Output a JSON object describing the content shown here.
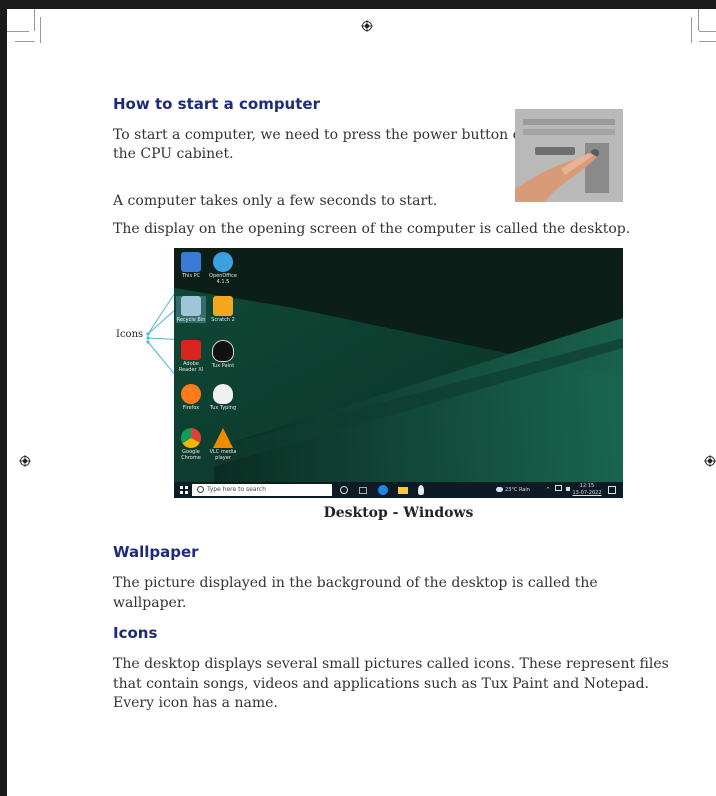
{
  "sections": {
    "start": {
      "heading": "How to start a computer",
      "para1_line1": "To start a computer, we need to press the power button on",
      "para1_line2": "the CPU cabinet.",
      "para2": "A computer takes only a few seconds to start.",
      "para3": "The display on the opening screen of the computer is called the desktop."
    },
    "figure": {
      "icons_label": "Icons",
      "caption": "Desktop - Windows",
      "desktop_icons": [
        {
          "label": "This PC",
          "color": "#3a7bd5"
        },
        {
          "label": "OpenOffice 4.1.5",
          "color": "#3aa0e0"
        },
        {
          "label": "Recycle Bin",
          "color": "#9fc6d8"
        },
        {
          "label": "Scratch 2",
          "color": "#f2a81d"
        },
        {
          "label": "Adobe Reader XI",
          "color": "#d8231f"
        },
        {
          "label": "Tux Paint",
          "color": "#111111"
        },
        {
          "label": "Firefox",
          "color": "#ff7b1a"
        },
        {
          "label": "Tux Typing",
          "color": "#f0f0f0"
        },
        {
          "label": "Google Chrome",
          "color": "#db4437"
        },
        {
          "label": "VLC media player",
          "color": "#f18a00"
        }
      ],
      "taskbar": {
        "search_placeholder": "Type here to search",
        "weather": "23°C Rain",
        "time": "12:15",
        "date": "13-07-2022"
      }
    },
    "wallpaper": {
      "heading": "Wallpaper",
      "line1": "The picture displayed in the background of the desktop is called the",
      "line2": "wallpaper."
    },
    "icons": {
      "heading": "Icons",
      "line1": "The desktop displays several small pictures called icons. These represent files",
      "line2": "that contain songs, videos and applications such as Tux Paint and Notepad.",
      "line3": "Every icon has a name."
    }
  },
  "colors": {
    "heading": "#1f2a7a",
    "text": "#333333",
    "desktop_bg": "#0c3a2c",
    "callout_line": "#4fb3d9"
  }
}
